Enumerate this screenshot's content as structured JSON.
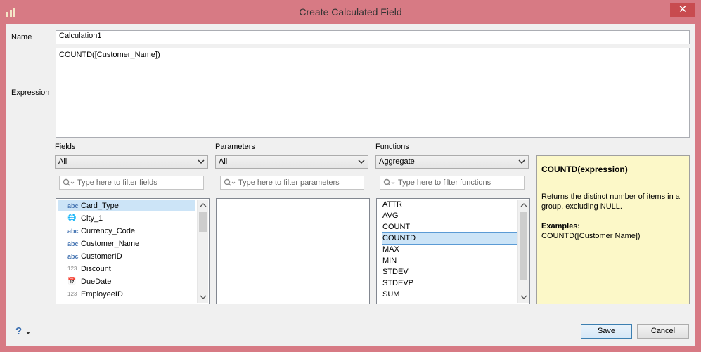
{
  "window": {
    "title": "Create Calculated Field",
    "close_glyph": "✕"
  },
  "name": {
    "label": "Name",
    "value": "Calculation1"
  },
  "expression": {
    "label": "Expression",
    "value": "COUNTD([Customer_Name])"
  },
  "fields": {
    "label": "Fields",
    "dropdown_value": "All",
    "filter_placeholder": "Type here to filter fields",
    "items": [
      {
        "type": "abc",
        "name": "Card_Type"
      },
      {
        "type": "geo",
        "name": "City_1"
      },
      {
        "type": "abc",
        "name": "Currency_Code"
      },
      {
        "type": "abc",
        "name": "Customer_Name"
      },
      {
        "type": "abc",
        "name": "CustomerID"
      },
      {
        "type": "123",
        "name": "Discount"
      },
      {
        "type": "date",
        "name": "DueDate"
      },
      {
        "type": "123",
        "name": "EmployeeID"
      }
    ]
  },
  "parameters": {
    "label": "Parameters",
    "dropdown_value": "All",
    "filter_placeholder": "Type here to filter parameters"
  },
  "functions": {
    "label": "Functions",
    "dropdown_value": "Aggregate",
    "filter_placeholder": "Type here to filter functions",
    "items": [
      "ATTR",
      "AVG",
      "COUNT",
      "COUNTD",
      "MAX",
      "MIN",
      "STDEV",
      "STDEVP",
      "SUM"
    ],
    "selected": "COUNTD"
  },
  "help": {
    "title": "COUNTD(expression)",
    "description": "Returns the distinct number of items in a group, excluding NULL.",
    "examples_label": "Examples:",
    "example": "COUNTD([Customer Name])"
  },
  "buttons": {
    "help": "?",
    "save": "Save",
    "cancel": "Cancel"
  },
  "colors": {
    "titlebar": "#d77a84",
    "close": "#c84b4f",
    "selection": "#cce4f7",
    "help_bg": "#fcf8c8"
  }
}
